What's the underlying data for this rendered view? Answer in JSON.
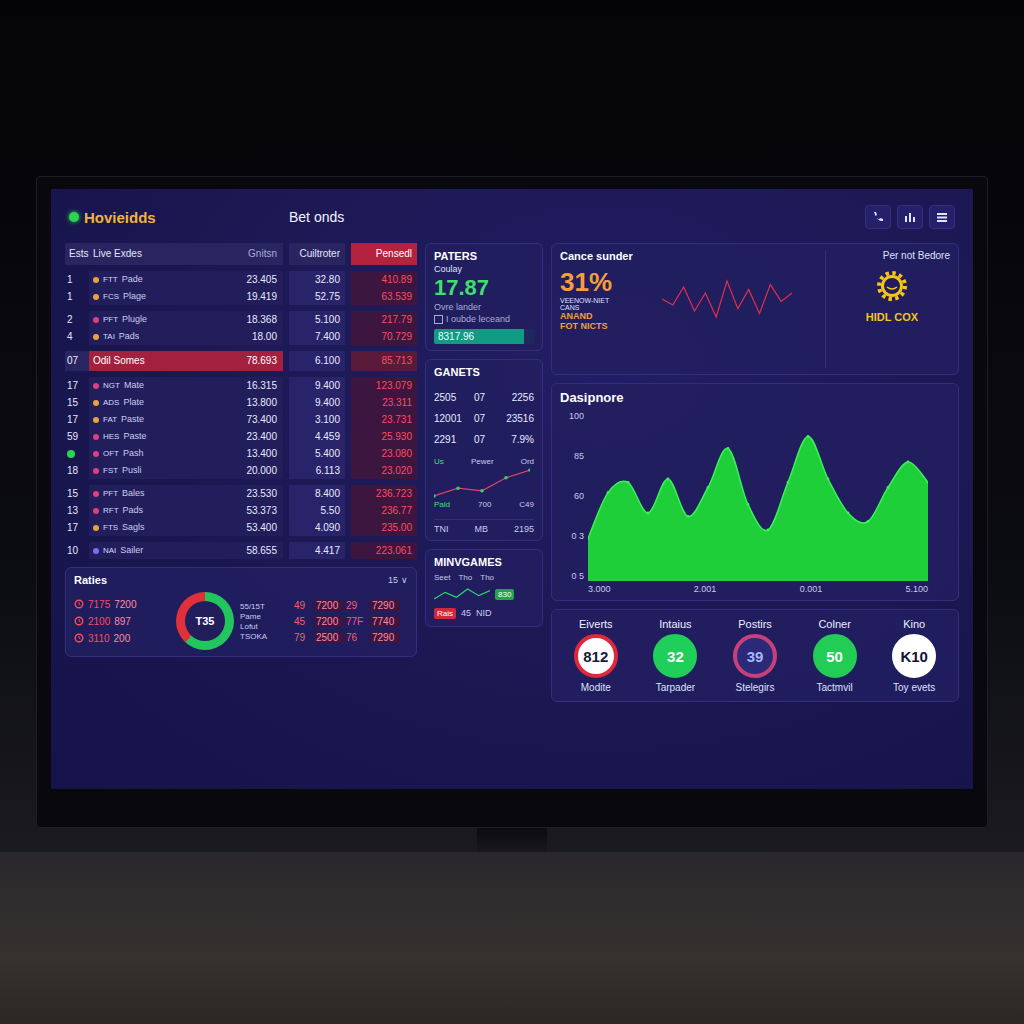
{
  "header": {
    "brand": "Hovieidds",
    "title": "Bet onds"
  },
  "table": {
    "columns": [
      "Ests",
      "Live Exdes",
      "Gnitsn",
      "Cuiltroter",
      "Pensedl"
    ],
    "groups": [
      {
        "kind": "rows",
        "rows": [
          {
            "rank": "1",
            "live": false,
            "code": "FTT",
            "name": "Pade",
            "a": "23.405",
            "b": "32.80",
            "c": "410.89",
            "color": "#e8a33a"
          },
          {
            "rank": "1",
            "live": false,
            "code": "FCS",
            "name": "Plage",
            "a": "19.419",
            "b": "52.75",
            "c": "63.539",
            "color": "#e8a33a"
          }
        ]
      },
      {
        "kind": "rows",
        "rows": [
          {
            "rank": "2",
            "live": false,
            "code": "PFT",
            "name": "Plugle",
            "a": "18.368",
            "b": "5.100",
            "c": "217.79",
            "color": "#e0407a"
          },
          {
            "rank": "4",
            "live": false,
            "code": "TAI",
            "name": "Pads",
            "a": "18.00",
            "b": "7.400",
            "c": "70.729",
            "color": "#e8a33a"
          }
        ]
      },
      {
        "kind": "section",
        "rank": "07",
        "name": "Odil Somes",
        "a": "78.693",
        "b": "6.100",
        "c": "85.713"
      },
      {
        "kind": "rows",
        "rows": [
          {
            "rank": "17",
            "live": false,
            "code": "NGT",
            "name": "Mate",
            "a": "16.315",
            "b": "9.400",
            "c": "123.079",
            "color": "#e0407a"
          },
          {
            "rank": "15",
            "live": false,
            "code": "ADS",
            "name": "Plate",
            "a": "13.800",
            "b": "9.400",
            "c": "23.311",
            "color": "#e8a33a"
          },
          {
            "rank": "17",
            "live": false,
            "code": "FAT",
            "name": "Paste",
            "a": "73.400",
            "b": "3.100",
            "c": "23.731",
            "color": "#e8a33a"
          },
          {
            "rank": "59",
            "live": false,
            "code": "HES",
            "name": "Paste",
            "a": "23.400",
            "b": "4.459",
            "c": "25.930",
            "color": "#e0407a"
          },
          {
            "rank": "",
            "live": true,
            "code": "OFT",
            "name": "Pash",
            "a": "13.400",
            "b": "5.400",
            "c": "23.080",
            "color": "#e0407a"
          },
          {
            "rank": "18",
            "live": false,
            "code": "FST",
            "name": "Pusli",
            "a": "20.000",
            "b": "6.113",
            "c": "23.020",
            "color": "#e0407a"
          }
        ]
      },
      {
        "kind": "rows",
        "rows": [
          {
            "rank": "15",
            "live": false,
            "code": "PFT",
            "name": "Bales",
            "a": "23.530",
            "b": "8.400",
            "c": "236.723",
            "color": "#e0407a"
          },
          {
            "rank": "13",
            "live": false,
            "code": "RFT",
            "name": "Pads",
            "a": "53.373",
            "b": "5.50",
            "c": "236.77",
            "color": "#e0407a"
          },
          {
            "rank": "17",
            "live": false,
            "code": "FTS",
            "name": "Sagls",
            "a": "53.400",
            "b": "4.090",
            "c": "235.00",
            "color": "#e8a33a"
          }
        ]
      },
      {
        "kind": "rows",
        "rows": [
          {
            "rank": "10",
            "live": false,
            "code": "NAI",
            "name": "Sailer",
            "a": "58.655",
            "b": "4.417",
            "c": "223.061",
            "color": "#7a6cff"
          }
        ]
      }
    ]
  },
  "raties": {
    "title": "Raties",
    "filter": "15",
    "caret": "∨",
    "list": [
      {
        "a": "7175",
        "b": "7200"
      },
      {
        "a": "2100",
        "b": "897"
      },
      {
        "a": "3110",
        "b": "200"
      }
    ],
    "donut": {
      "label": "T35",
      "segments": [
        {
          "color": "#22c55e",
          "level": 0.62
        },
        {
          "color": "#e0303a",
          "level": 0.38
        }
      ]
    },
    "legend": [
      "55/15T",
      "Pame",
      "Lofut",
      "TSOKA"
    ],
    "grid": [
      [
        "49",
        "7200",
        "29",
        "7290"
      ],
      [
        "45",
        "7200",
        "77F",
        "7740"
      ],
      [
        "79",
        "2500",
        "76",
        "7290"
      ]
    ]
  },
  "paters": {
    "title": "PATERS",
    "label": "Coulay",
    "value": "17.87",
    "sub": "Ovre lander",
    "check": {
      "label": "I oubde leceand",
      "checked": false
    },
    "bar": {
      "text": "8317.96",
      "level": 0.9
    }
  },
  "ganets": {
    "title": "GANETS",
    "rows": [
      [
        "2505",
        "07",
        "2256"
      ],
      [
        "12001",
        "07",
        "23516"
      ],
      [
        "2291",
        "07",
        "7.9%"
      ]
    ],
    "trend": [
      10,
      25,
      20,
      45,
      60
    ],
    "legend_top": [
      "Us",
      "Pewer",
      "Ord"
    ],
    "legend_bottom": [
      "Paid",
      "700",
      "C49"
    ],
    "footer": [
      "TNI",
      "MB",
      "2195"
    ]
  },
  "minigames": {
    "title": "MINVGAMES",
    "columns": [
      "Seet",
      "Tho",
      "Tho"
    ],
    "rows": [
      {
        "kind": "spark",
        "values": [
          30,
          50,
          35,
          60,
          40,
          55
        ],
        "tag": "830",
        "color": "#1fa64a"
      },
      {
        "kind": "text",
        "tag": "Rais",
        "color": "#d02a3a",
        "mid": "45",
        "right": "NID"
      }
    ]
  },
  "summary": {
    "title": "Cance sunder",
    "percent": "31%",
    "notes": [
      "VEENOW-NIET",
      "CANS"
    ],
    "highlights": [
      "ANAND",
      "FOT NICTS"
    ],
    "trend": [
      50,
      45,
      60,
      40,
      55,
      35,
      65,
      42,
      58,
      38,
      62,
      48,
      55
    ],
    "side": {
      "title": "Per not Bedore",
      "label": "HIDL COX"
    }
  },
  "chart": {
    "title": "Dasipnore",
    "y_ticks": [
      "100",
      "85",
      "60",
      "0 3",
      "0 5"
    ],
    "x_ticks": [
      "3.000",
      "2.001",
      "0.001",
      "5.100"
    ],
    "series": [
      {
        "values": [
          25,
          52,
          58,
          40,
          60,
          38,
          55,
          78,
          45,
          30,
          58,
          85,
          60,
          40,
          35,
          55,
          70,
          58
        ]
      }
    ]
  },
  "events": {
    "items": [
      {
        "label": "Eiverts",
        "value": "812",
        "caption": "Modite",
        "kind": "ring",
        "color": "#e0283c"
      },
      {
        "label": "Intaius",
        "value": "32",
        "caption": "Tarpader",
        "kind": "solid",
        "color": "#1fcf5a"
      },
      {
        "label": "Postirs",
        "value": "39",
        "caption": "Stelegirs",
        "kind": "ring-dark",
        "color": "#c8407a"
      },
      {
        "label": "Colner",
        "value": "50",
        "caption": "Tactmvil",
        "kind": "solid",
        "color": "#22cc55"
      },
      {
        "label": "Kino",
        "value": "K10",
        "caption": "Toy evets",
        "kind": "solid",
        "color": "#ffffff"
      }
    ]
  }
}
